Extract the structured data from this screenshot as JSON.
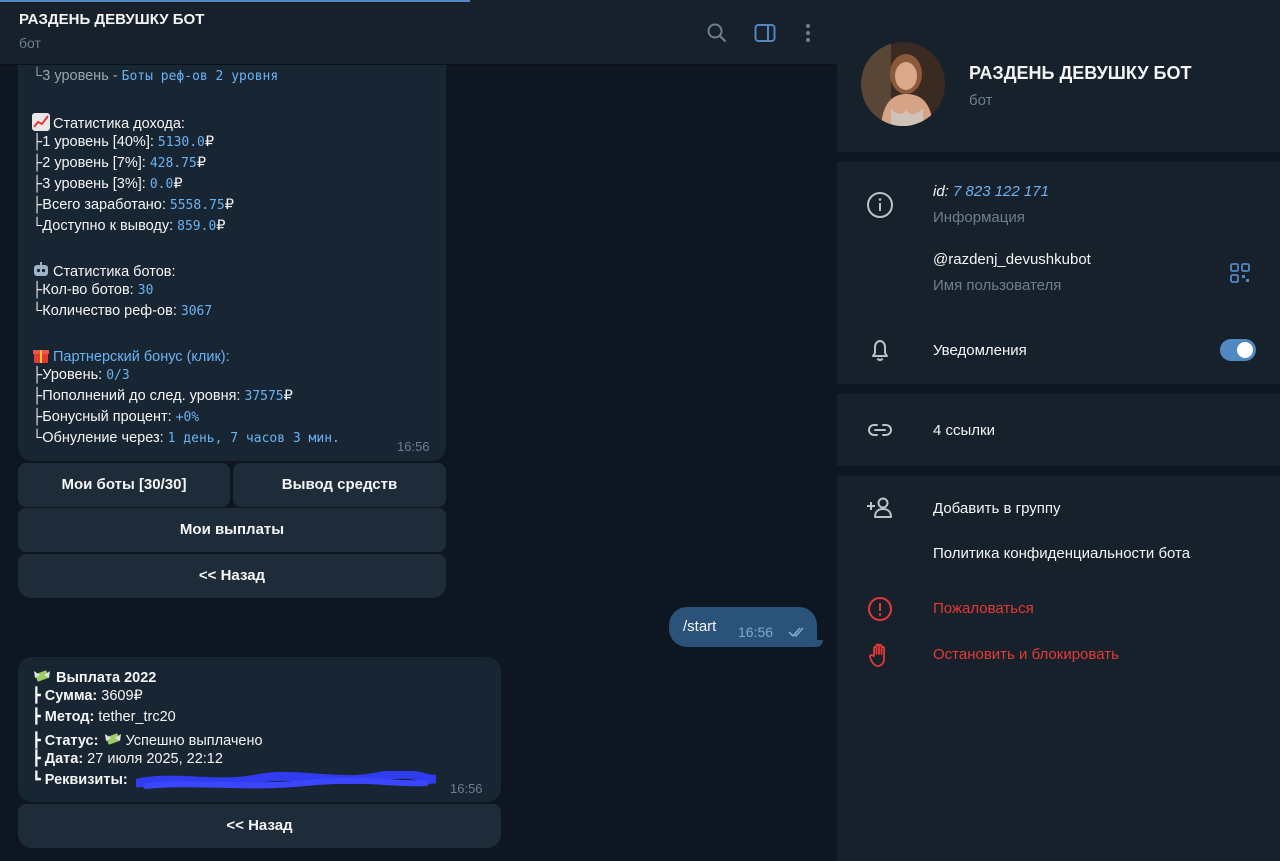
{
  "chat": {
    "title": "РАЗДЕНЬ ДЕВУШКУ БОТ",
    "subtitle": "бот",
    "icons": [
      "search-icon",
      "sidebar-toggle-icon",
      "more-icon"
    ]
  },
  "message1": {
    "l3_label": "└3 уровень - ",
    "l3_value": "Боты реф-ов 2 уровня",
    "income_header": "Статистика дохода:",
    "income": [
      {
        "label": "├1 уровень [40%]: ",
        "value": "5130.0",
        "cur": "₽"
      },
      {
        "label": "├2 уровень [7%]: ",
        "value": "428.75",
        "cur": "₽"
      },
      {
        "label": "├3 уровень [3%]: ",
        "value": "0.0",
        "cur": "₽"
      },
      {
        "label": "├Всего заработано: ",
        "value": "5558.75",
        "cur": "₽"
      },
      {
        "label": "└Доступно к выводу: ",
        "value": "859.0",
        "cur": "₽"
      }
    ],
    "bots_header": "Статистика ботов:",
    "bots": [
      {
        "label": "├Кол-во ботов: ",
        "value": "30"
      },
      {
        "label": "└Количество реф-ов: ",
        "value": "3067"
      }
    ],
    "bonus_header": "Партнерский бонус (клик):",
    "bonus": [
      {
        "label": "├Уровень: ",
        "value": "0/3",
        "cur": ""
      },
      {
        "label": "├Пополнений до след. уровня: ",
        "value": "37575",
        "cur": "₽"
      },
      {
        "label": "├Бонусный процент: ",
        "value": "+0%",
        "cur": ""
      },
      {
        "label": "└Обнуление через: ",
        "value": "1 день, 7 часов 3 мин.",
        "cur": ""
      }
    ],
    "time": "16:56",
    "buttons": {
      "my_bots": "Мои боты [30/30]",
      "withdraw": "Вывод средств",
      "my_payouts": "Мои выплаты",
      "back": "<< Назад"
    }
  },
  "outgoing": {
    "text": "/start",
    "time": "16:56"
  },
  "message2": {
    "title": "Выплата 2022",
    "sum_label": "┣ Сумма:",
    "sum": " 3609₽",
    "method_label": "┣ Метод:",
    "method": " tether_trc20",
    "status_label": "┣ Статус:",
    "status": "Успешно выплачено",
    "date_label": "┣ Дата:",
    "date": " 27 июля 2025, 22:12",
    "req_label": "┗ Реквизиты:",
    "time": "16:56",
    "back": "<< Назад"
  },
  "panel": {
    "name": "РАЗДЕНЬ ДЕВУШКУ БОТ",
    "sub": "бот",
    "id_prefix": "id: ",
    "id": "7 823 122 171",
    "info_label": "Информация",
    "username": "@razdenj_devushkubot",
    "username_label": "Имя пользователя",
    "notifications": "Уведомления",
    "notifications_on": true,
    "links": "4 ссылки",
    "add_to_group": "Добавить в группу",
    "privacy": "Политика конфиденциальности бота",
    "report": "Пожаловаться",
    "block": "Остановить и блокировать",
    "colors": {
      "accent": "#5288c1",
      "danger": "#e53935",
      "link": "#6ab3f3"
    }
  }
}
